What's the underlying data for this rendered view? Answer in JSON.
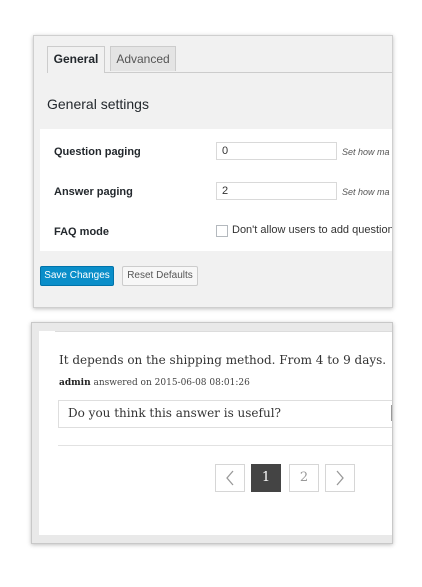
{
  "settings": {
    "tabs": [
      {
        "label": "General",
        "active": true
      },
      {
        "label": "Advanced",
        "active": false
      }
    ],
    "section_title": "General settings",
    "rows": [
      {
        "label": "Question paging",
        "value": "0",
        "hint": "Set how ma"
      },
      {
        "label": "Answer paging",
        "value": "2",
        "hint": "Set how ma"
      },
      {
        "label": "FAQ mode",
        "checkbox_label": "Don't allow users to add question",
        "checked": false
      }
    ],
    "buttons": {
      "save": "Save Changes",
      "reset": "Reset Defaults"
    },
    "colors": {
      "primary": "#0a8ec9",
      "panel_bg": "#f1f1f1"
    }
  },
  "answer": {
    "text": "It depends on the shipping method. From 4 to 9 days.",
    "author": "admin",
    "meta": "answered on 2015-06-08 08:01:26",
    "useful_prompt": "Do you think this answer is useful?"
  },
  "pagination": {
    "prev_icon": "chevron-left-icon",
    "next_icon": "chevron-right-icon",
    "pages": [
      "1",
      "2"
    ],
    "current": "1"
  }
}
